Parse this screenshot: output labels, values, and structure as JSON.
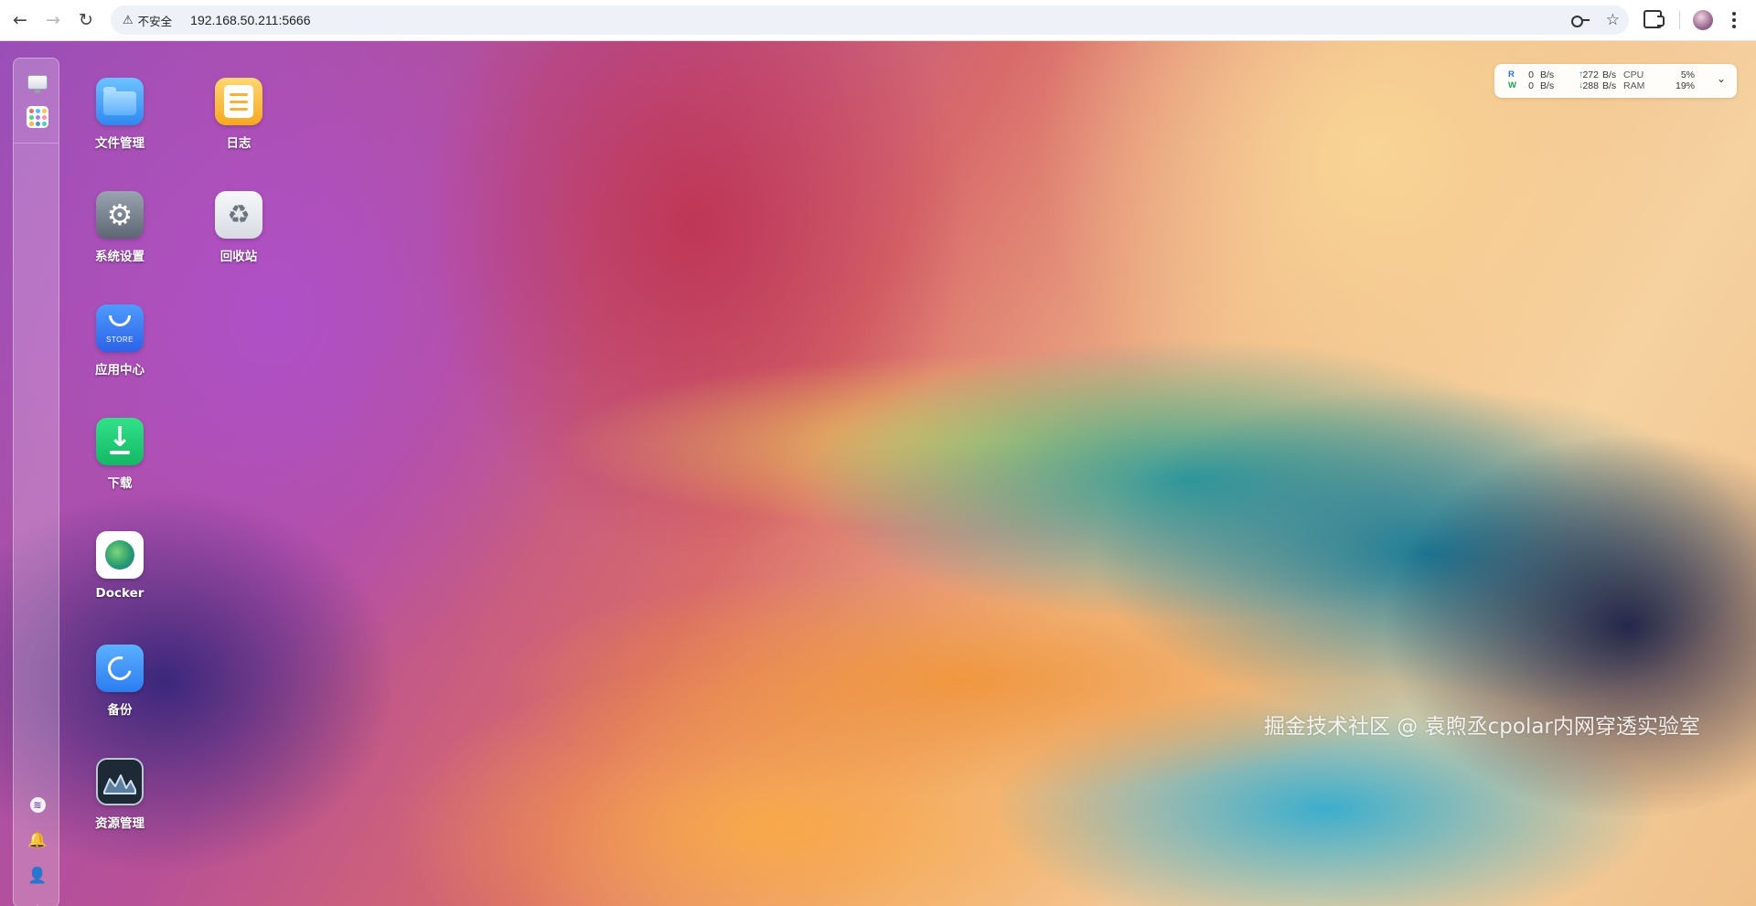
{
  "browser": {
    "back_icon": "arrow-left-icon",
    "forward_icon": "arrow-right-icon",
    "reload_icon": "reload-icon",
    "security_label": "不安全",
    "url": "192.168.50.211:5666"
  },
  "sidebar": {
    "top_items": [
      "monitor-icon",
      "apps-grid-icon"
    ],
    "bottom_items": [
      "fn-logo-icon",
      "bell-icon",
      "user-icon",
      "settings-icon"
    ]
  },
  "desktop": {
    "apps": [
      {
        "label": "文件管理",
        "icon": "folder-icon"
      },
      {
        "label": "日志",
        "icon": "log-icon"
      },
      {
        "label": "系统设置",
        "icon": "settings-gear-icon"
      },
      {
        "label": "回收站",
        "icon": "recycle-bin-icon"
      },
      {
        "label": "应用中心",
        "icon": "app-store-icon",
        "tile_text": "STORE"
      },
      {
        "label": "下载",
        "icon": "download-icon"
      },
      {
        "label": "Docker",
        "icon": "docker-icon"
      },
      {
        "label": "备份",
        "icon": "backup-icon"
      },
      {
        "label": "资源管理",
        "icon": "resource-monitor-icon"
      }
    ]
  },
  "monitor_widget": {
    "read_label": "R",
    "write_label": "W",
    "disk_read": "0",
    "disk_write": "0",
    "disk_unit": "B/s",
    "net_up": "272",
    "net_down": "288",
    "net_unit": "B/s",
    "cpu_label": "CPU",
    "cpu_value": "5%",
    "ram_label": "RAM",
    "ram_value": "19%"
  },
  "watermark": "掘金技术社区 @ 袁煦丞cpolar内网穿透实验室",
  "colors": {
    "accent": "#2b6fdc",
    "write_green": "#1ea35c"
  }
}
